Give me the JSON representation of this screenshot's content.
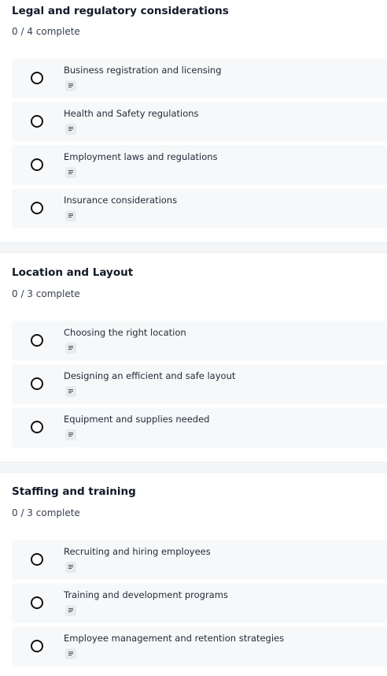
{
  "sections": [
    {
      "title": "Legal and regulatory considerations",
      "progress": "0 / 4 complete",
      "tasks": [
        {
          "label": "Business registration and licensing",
          "note_icon": "notes-icon",
          "completed": false
        },
        {
          "label": "Health and Safety regulations",
          "note_icon": "notes-icon",
          "completed": false
        },
        {
          "label": "Employment laws and regulations",
          "note_icon": "notes-icon",
          "completed": false
        },
        {
          "label": "Insurance considerations",
          "note_icon": "notes-icon",
          "completed": false
        }
      ]
    },
    {
      "title": "Location and Layout",
      "progress": "0 / 3 complete",
      "tasks": [
        {
          "label": "Choosing the right location",
          "note_icon": "notes-icon",
          "completed": false
        },
        {
          "label": "Designing an efficient and safe layout",
          "note_icon": "notes-icon",
          "completed": false
        },
        {
          "label": "Equipment and supplies needed",
          "note_icon": "notes-icon",
          "completed": false
        }
      ]
    },
    {
      "title": "Staffing and training",
      "progress": "0 / 3 complete",
      "tasks": [
        {
          "label": "Recruiting and hiring employees",
          "note_icon": "notes-icon",
          "completed": false
        },
        {
          "label": "Training and development programs",
          "note_icon": "notes-icon",
          "completed": false
        },
        {
          "label": "Employee management and retention strategies",
          "note_icon": "notes-icon",
          "completed": false
        }
      ]
    }
  ],
  "colors": {
    "task_background": "#f7f8f9",
    "divider": "#f3f5f7",
    "checkbox_border": "#111111"
  }
}
